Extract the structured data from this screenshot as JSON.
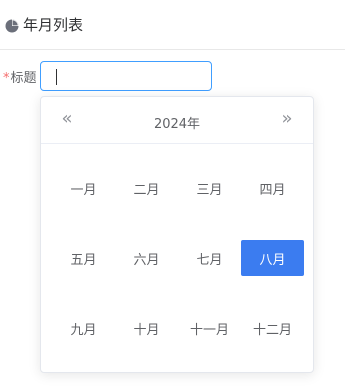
{
  "header": {
    "title": "年月列表"
  },
  "form": {
    "required_mark": "*",
    "label": "标题",
    "input_value": ""
  },
  "picker": {
    "prev_year": "«",
    "next_year": "»",
    "year": "2024年",
    "selected_index": 7,
    "months": [
      "一月",
      "二月",
      "三月",
      "四月",
      "五月",
      "六月",
      "七月",
      "八月",
      "九月",
      "十月",
      "十一月",
      "十二月"
    ]
  },
  "colors": {
    "accent": "#3b7cf0",
    "required": "#f56c6c",
    "border_focus": "#409eff"
  },
  "icons": {
    "header": "pie-chart-icon"
  }
}
